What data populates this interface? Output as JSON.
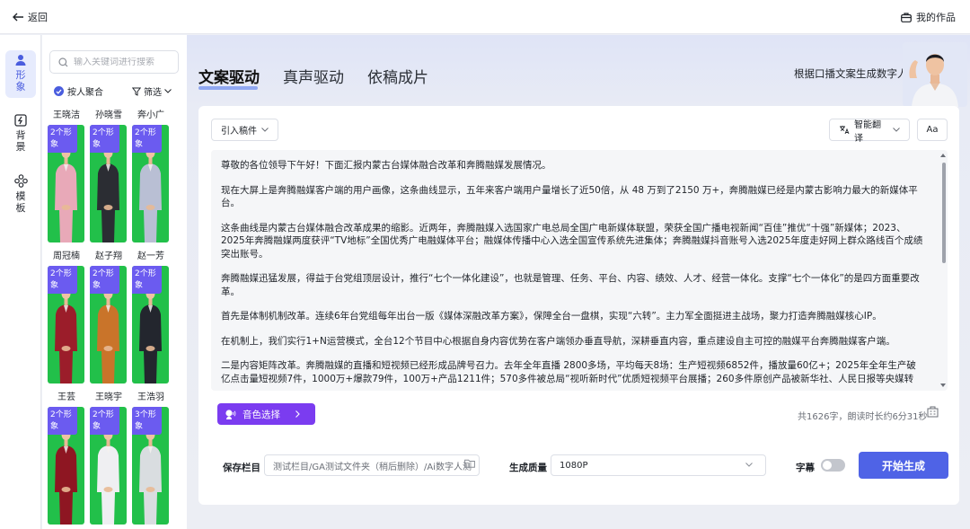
{
  "topbar": {
    "back_label": "返回",
    "works_label": "我的作品"
  },
  "rail": {
    "items": [
      {
        "label": "形象",
        "icon": "person-icon",
        "active": true
      },
      {
        "label": "背景",
        "icon": "background-icon",
        "active": false
      },
      {
        "label": "模板",
        "icon": "template-icon",
        "active": false
      }
    ]
  },
  "panel": {
    "search_placeholder": "输入关键词进行搜索",
    "aggregate_label": "按人聚合",
    "filter_label": "筛选",
    "avatars": [
      {
        "name": "王晓洁",
        "tag": "2个形象",
        "suit": "#e8a9b8",
        "bg": "#22c04a"
      },
      {
        "name": "孙晓雪",
        "tag": "2个形象",
        "suit": "#2b2d33",
        "bg": "#22c04a"
      },
      {
        "name": "奔小广",
        "tag": "2个形象",
        "suit": "#b9bfd4",
        "bg": "#22c04a"
      },
      {
        "name": "周冠楠",
        "tag": "2个形象",
        "suit": "#9b1d2a",
        "bg": "#22c04a"
      },
      {
        "name": "赵子翔",
        "tag": "2个形象",
        "suit": "#c9742a",
        "bg": "#22c04a"
      },
      {
        "name": "赵一芳",
        "tag": "2个形象",
        "suit": "#23262e",
        "bg": "#22c04a"
      },
      {
        "name": "王芸",
        "tag": "2个形象",
        "suit": "#8e1622",
        "bg": "#22c04a"
      },
      {
        "name": "王晓宇",
        "tag": "2个形象",
        "suit": "#efeff2",
        "bg": "#22c04a"
      },
      {
        "name": "王浩羽",
        "tag": "3个形象",
        "suit": "#d9dde0",
        "bg": "#22c04a"
      }
    ]
  },
  "main": {
    "tabs": [
      "文案驱动",
      "真声驱动",
      "依稿成片"
    ],
    "hint": "根据口播文案生成数字人",
    "import_label": "引入稿件",
    "translate_label": "智能翻译",
    "font_label": "Aa",
    "paragraphs": [
      "尊敬的各位领导下午好！下面汇报内蒙古台媒体融合改革和奔腾融媒发展情况。",
      "现在大屏上是奔腾融媒客户端的用户画像，这条曲线显示，五年来客户端用户量增长了近50倍，从 48 万到了2150 万+，奔腾融媒已经是内蒙古影响力最大的新媒体平台。",
      "这条曲线是内蒙古台媒体融合改革成果的缩影。近两年，奔腾融媒入选国家广电总局全国广电新媒体联盟，荣获全国广播电视新闻“百佳”推优“十强”新媒体；2023、2025年奔腾融媒两度获评“TV地标”全国优秀广电融媒体平台；融媒体传播中心入选全国宣传系统先进集体；奔腾融媒抖音账号入选2025年度走好网上群众路线百个成绩突出账号。",
      "奔腾融媒迅猛发展，得益于台党组顶层设计，推行“七个一体化建设”，也就是管理、任务、平台、内容、绩效、人才、经营一体化。支撑“七个一体化”的是四方面重要改革。",
      "首先是体制机制改革。连续6年台党组每年出台一版《媒体深融改革方案》，保障全台一盘棋，实现“六转”。主力军全面挺进主战场，聚力打造奔腾融媒核心IP。",
      "在机制上，我们实行1+N运营模式，全台12个节目中心根据自身内容优势在客户端领办垂直导航，深耕垂直内容，重点建设自主可控的融媒平台奔腾融媒客户端。",
      "二是内容矩阵改革。奔腾融媒的直播和短视频已经形成品牌号召力。去年全年直播 2800多场，平均每天8场：生产短视频6852件，播放量60亿+；2025年全年生产破亿点击量短视频7件，1000万+爆款79件，100万+产品1211件；570多件被总局“视听新时代”优质短视频平台展播；260多件原创产品被新华社、人民日报等央媒转"
    ],
    "voice_label": "音色选择",
    "count_text": "共1626字，朗读时长约6分31秒",
    "save_label": "保存栏目",
    "save_path": "测试栏目/GA测试文件夹（稍后删除）/Ai数字人测",
    "quality_label": "生成质量",
    "quality_value": "1080P",
    "subtitle_label": "字幕",
    "start_label": "开始生成"
  }
}
